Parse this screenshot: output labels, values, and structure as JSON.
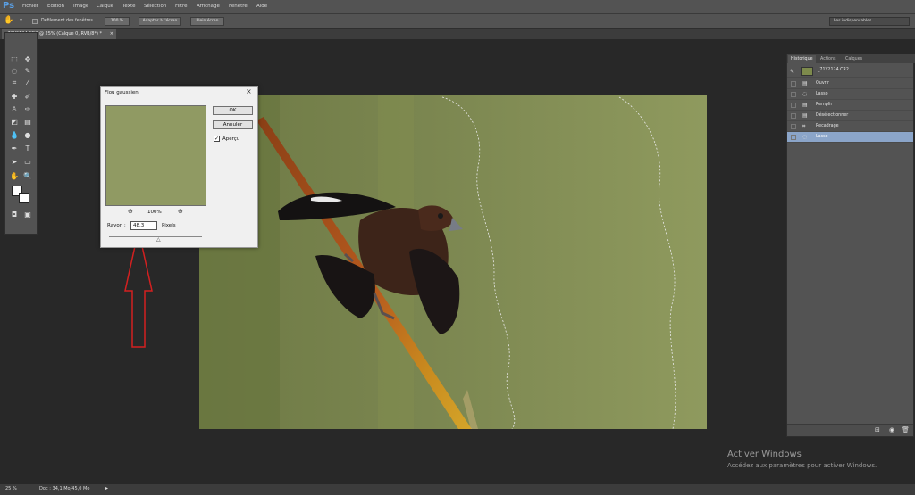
{
  "app": {
    "logo": "Ps"
  },
  "menu": [
    "Fichier",
    "Edition",
    "Image",
    "Calque",
    "Texte",
    "Sélection",
    "Filtre",
    "Affichage",
    "Fenêtre",
    "Aide"
  ],
  "options_bar": {
    "scroll_all_label": "Défilement des fenêtres",
    "btn_100": "100 %",
    "btn_fit": "Adapter à l'écran",
    "btn_fill": "Plein écran",
    "workspace": "Les indispensables"
  },
  "document_tab": {
    "label": "_71Y2124.CR2 @ 25% (Calque 0, RVB/8*) *"
  },
  "panel": {
    "tabs": [
      "Historique",
      "Actions",
      "Calques"
    ],
    "snapshot": "_71Y2124.CR2",
    "history": [
      {
        "label": "Ouvrir",
        "icon": "document-icon"
      },
      {
        "label": "Lasso",
        "icon": "lasso-icon"
      },
      {
        "label": "Remplir",
        "icon": "document-icon"
      },
      {
        "label": "Désélectionner",
        "icon": "document-icon"
      },
      {
        "label": "Recadrage",
        "icon": "crop-icon"
      },
      {
        "label": "Lasso",
        "icon": "lasso-icon"
      }
    ]
  },
  "dialog": {
    "title": "Flou gaussien",
    "ok": "OK",
    "cancel": "Annuler",
    "preview_label": "Aperçu",
    "preview_checked": true,
    "zoom": "100%",
    "radius_label": "Rayon :",
    "radius_value": "48,3",
    "radius_unit": "Pixels"
  },
  "status": {
    "zoom": "25 %",
    "doc": "Doc : 34,1 Mo/45,0 Mo"
  },
  "watermark": {
    "title": "Activer Windows",
    "subtitle": "Accédez aux paramètres pour activer Windows."
  },
  "colors": {
    "accent": "#5aa0e6",
    "selected_row": "#8ba5c9",
    "arrow": "#d42020",
    "bg_green": "#8f9a5e"
  }
}
